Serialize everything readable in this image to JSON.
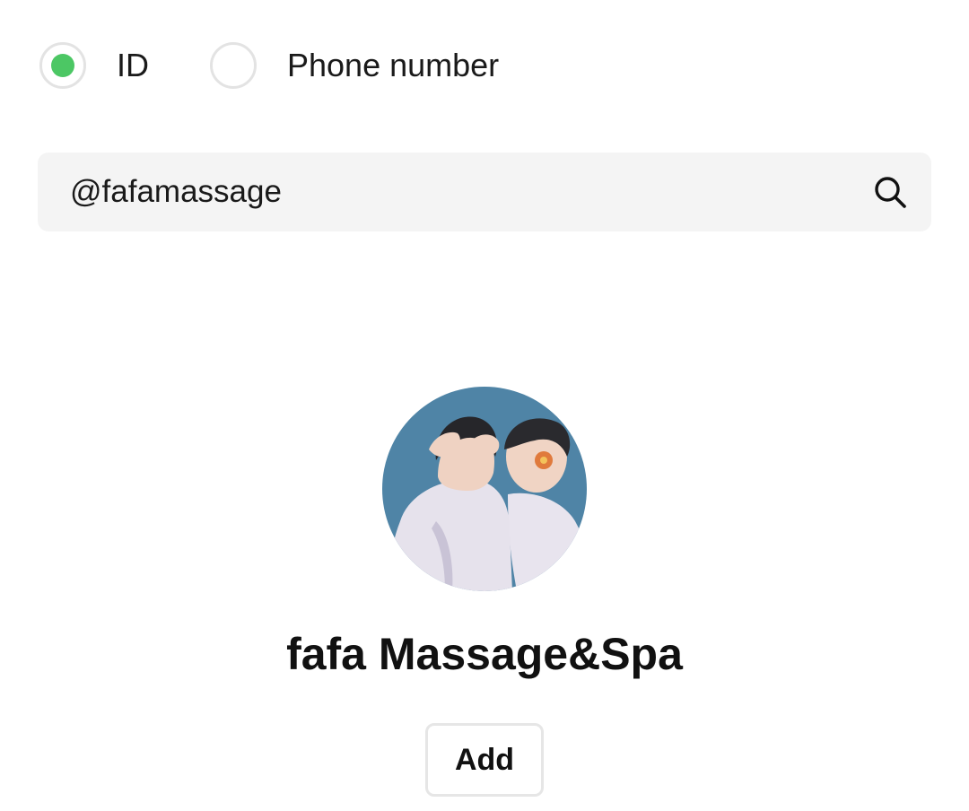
{
  "search_type": {
    "options": [
      {
        "label": "ID",
        "selected": true
      },
      {
        "label": "Phone number",
        "selected": false
      }
    ]
  },
  "search": {
    "value": "@fafamassage",
    "icon": "search-icon"
  },
  "result": {
    "avatar_icon": "profile-avatar",
    "name": "fafa Massage&Spa",
    "add_label": "Add"
  },
  "colors": {
    "accent": "#4cc764",
    "search_bg": "#f4f4f4",
    "border": "#e3e3e3"
  }
}
